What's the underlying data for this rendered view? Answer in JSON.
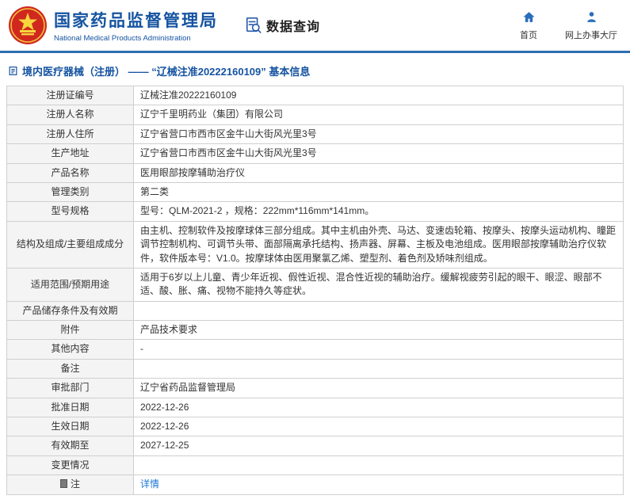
{
  "header": {
    "org_name_cn": "国家药品监督管理局",
    "org_name_en": "National Medical Products Administration",
    "data_query_label": "数据查询",
    "nav_home": "首页",
    "nav_service_hall": "网上办事大厅"
  },
  "page": {
    "breadcrumb": "境内医疗器械（注册） —— “辽械注准20222160109” 基本信息"
  },
  "colors": {
    "brand_blue": "#1553a1",
    "divider_blue": "#2e6db4",
    "link_blue": "#1a75d2",
    "emblem_red": "#d0281e",
    "label_bg": "#f4f4f4"
  },
  "table": {
    "rows": [
      {
        "label": "注册证编号",
        "value": "辽械注准20222160109"
      },
      {
        "label": "注册人名称",
        "value": "辽宁千里明药业（集团）有限公司"
      },
      {
        "label": "注册人住所",
        "value": "辽宁省营口市西市区金牛山大街风光里3号"
      },
      {
        "label": "生产地址",
        "value": "辽宁省营口市西市区金牛山大街风光里3号"
      },
      {
        "label": "产品名称",
        "value": "医用眼部按摩辅助治疗仪"
      },
      {
        "label": "管理类别",
        "value": "第二类"
      },
      {
        "label": "型号规格",
        "value": "型号：QLM-2021-2 ，规格：222mm*116mm*141mm。"
      },
      {
        "label": "结构及组成/主要组成成分",
        "value": "由主机、控制软件及按摩球体三部分组成。其中主机由外壳、马达、变速齿轮箱、按摩头、按摩头运动机构、瞳距调节控制机构、可调节头带、面部隔离承托结构、扬声器、屏幕、主板及电池组成。医用眼部按摩辅助治疗仪软件，软件版本号：V1.0。按摩球体由医用聚氯乙烯、塑型剂、着色剂及矫味剂组成。"
      },
      {
        "label": "适用范围/预期用途",
        "value": "适用于6岁以上儿童、青少年近视、假性近视、混合性近视的辅助治疗。缓解视疲劳引起的眼干、眼涩、眼部不适、酸、胀、痛、视物不能持久等症状。"
      },
      {
        "label": "产品储存条件及有效期",
        "value": ""
      },
      {
        "label": "附件",
        "value": "产品技术要求"
      },
      {
        "label": "其他内容",
        "value": "-"
      },
      {
        "label": "备注",
        "value": ""
      },
      {
        "label": "审批部门",
        "value": "辽宁省药品监督管理局"
      },
      {
        "label": "批准日期",
        "value": "2022-12-26"
      },
      {
        "label": "生效日期",
        "value": "2022-12-26"
      },
      {
        "label": "有效期至",
        "value": "2027-12-25"
      },
      {
        "label": "变更情况",
        "value": ""
      },
      {
        "label": "注",
        "value": "详情",
        "icon": true,
        "link": true
      }
    ]
  }
}
